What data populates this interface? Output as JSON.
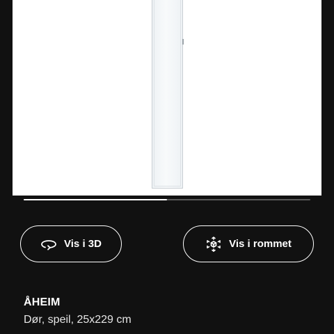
{
  "product": {
    "name": "ÅHEIM",
    "description": "Dør, speil, 25x229 cm"
  },
  "gallery": {
    "progress_fraction": 0.5
  },
  "actions": {
    "view_3d_label": "Vis i 3D",
    "view_3d_icon": "rotate-3d-icon",
    "view_in_room_label": "Vis i rommet",
    "view_in_room_icon": "ar-view-icon"
  },
  "colors": {
    "background": "#111111",
    "text": "#ffffff"
  }
}
